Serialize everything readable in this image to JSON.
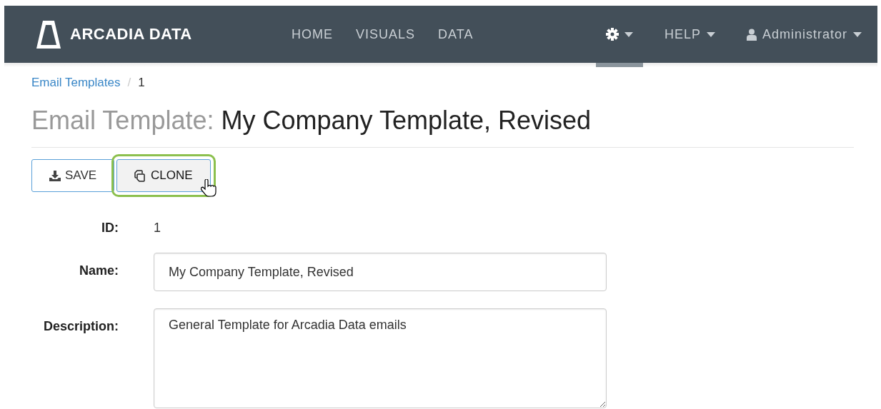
{
  "navbar": {
    "brand": "ARCADIA DATA",
    "links": [
      {
        "label": "HOME",
        "selected": false
      },
      {
        "label": "VISUALS",
        "selected": false
      },
      {
        "label": "DATA",
        "selected": false
      }
    ],
    "settings": {
      "selected": true
    },
    "help": "HELP",
    "user": "Administrator"
  },
  "breadcrumb": {
    "items": [
      "Email Templates",
      "1"
    ],
    "separator": "/"
  },
  "title": {
    "prefix": "Email Template:",
    "name": "My Company Template, Revised"
  },
  "buttons": [
    {
      "kind": "save",
      "label": "SAVE",
      "highlighted": false
    },
    {
      "kind": "clone",
      "label": "CLONE",
      "highlighted": true
    }
  ],
  "fields": [
    {
      "kind": "static",
      "label": "ID:",
      "value": "1"
    },
    {
      "kind": "input",
      "label": "Name:",
      "value": "My Company Template, Revised"
    },
    {
      "kind": "textarea",
      "label": "Description:",
      "value": "General Template for Arcadia Data emails"
    }
  ]
}
